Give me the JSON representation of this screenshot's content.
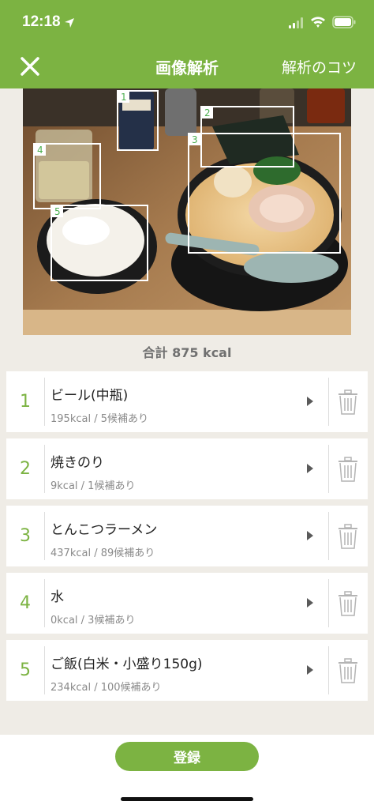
{
  "status_bar": {
    "time": "12:18"
  },
  "nav": {
    "title": "画像解析",
    "tips_label": "解析のコツ"
  },
  "photo": {
    "boxes": [
      {
        "num": "1"
      },
      {
        "num": "2"
      },
      {
        "num": "3"
      },
      {
        "num": "4"
      },
      {
        "num": "5"
      }
    ]
  },
  "summary": {
    "total_label": "合計 875 kcal"
  },
  "items": [
    {
      "index": "1",
      "name": "ビール(中瓶)",
      "sub": "195kcal / 5候補あり"
    },
    {
      "index": "2",
      "name": "焼きのり",
      "sub": "9kcal / 1候補あり"
    },
    {
      "index": "3",
      "name": "とんこつラーメン",
      "sub": "437kcal / 89候補あり"
    },
    {
      "index": "4",
      "name": "水",
      "sub": "0kcal / 3候補あり"
    },
    {
      "index": "5",
      "name": "ご飯(白米・小盛り150g)",
      "sub": "234kcal / 100候補あり"
    }
  ],
  "footer": {
    "register_label": "登録"
  },
  "colors": {
    "accent": "#7cb342",
    "background": "#efece6",
    "box_label": "#4caf50"
  }
}
